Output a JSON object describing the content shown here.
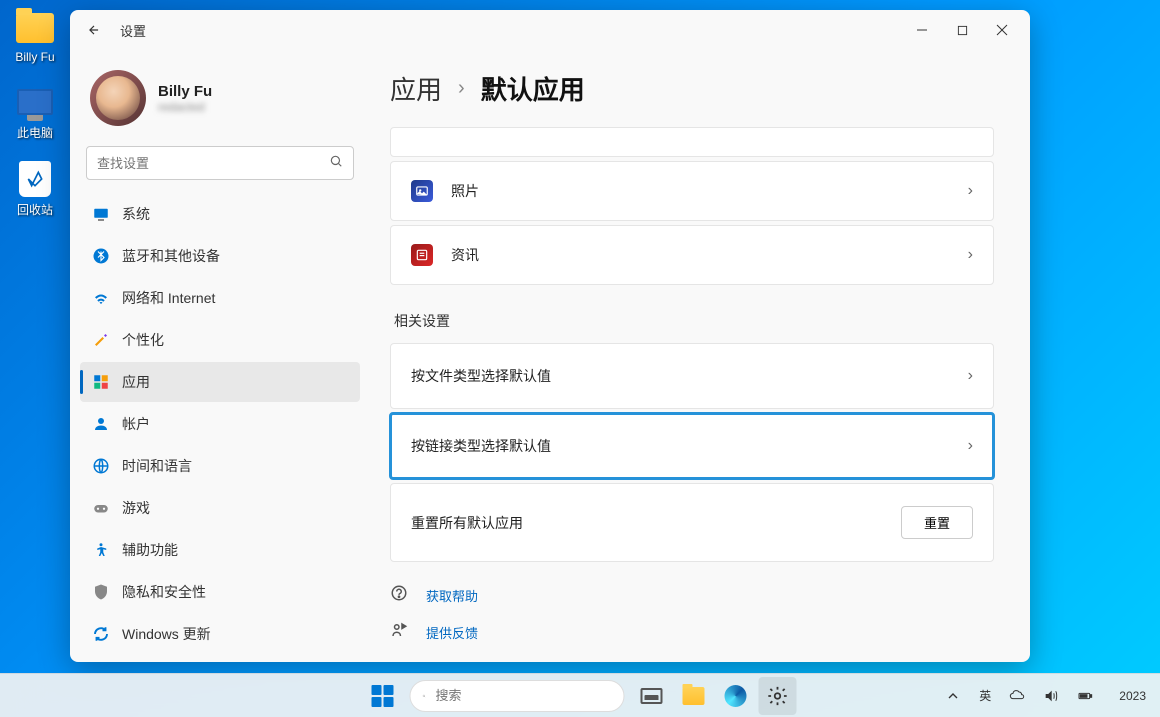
{
  "desktop": {
    "items": [
      {
        "label": "Billy Fu"
      },
      {
        "label": "此电脑"
      },
      {
        "label": "回收站"
      }
    ]
  },
  "window": {
    "title": "设置",
    "profile": {
      "name": "Billy Fu",
      "email": "redacted"
    },
    "search": {
      "placeholder": "查找设置"
    },
    "nav": [
      {
        "label": "系统"
      },
      {
        "label": "蓝牙和其他设备"
      },
      {
        "label": "网络和 Internet"
      },
      {
        "label": "个性化"
      },
      {
        "label": "应用"
      },
      {
        "label": "帐户"
      },
      {
        "label": "时间和语言"
      },
      {
        "label": "游戏"
      },
      {
        "label": "辅助功能"
      },
      {
        "label": "隐私和安全性"
      },
      {
        "label": "Windows 更新"
      }
    ],
    "breadcrumb": {
      "parent": "应用",
      "current": "默认应用"
    },
    "apps": [
      {
        "label": "照片"
      },
      {
        "label": "资讯"
      }
    ],
    "related_section_title": "相关设置",
    "related": [
      {
        "label": "按文件类型选择默认值"
      },
      {
        "label": "按链接类型选择默认值"
      },
      {
        "label": "重置所有默认应用",
        "action": "重置"
      }
    ],
    "help": [
      {
        "label": "获取帮助"
      },
      {
        "label": "提供反馈"
      }
    ]
  },
  "taskbar": {
    "search_placeholder": "搜索",
    "lang": "英",
    "year": "2023"
  }
}
